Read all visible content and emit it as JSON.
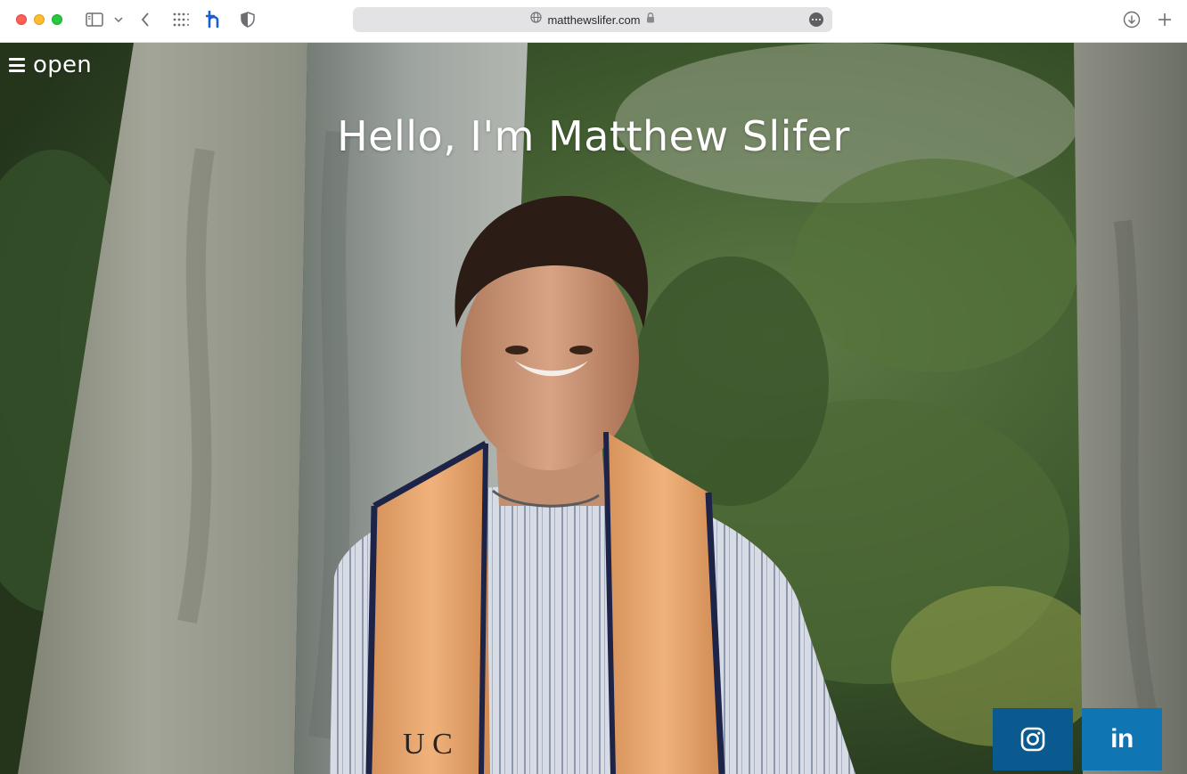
{
  "browser": {
    "url": "matthewslifer.com",
    "icons": [
      "sidebar-icon",
      "chevron-down-icon",
      "back-icon",
      "grid-icon",
      "honey-extension-icon",
      "shield-icon",
      "globe-icon",
      "lock-icon",
      "more-icon",
      "download-icon",
      "new-tab-icon"
    ]
  },
  "nav": {
    "menu_label": "open",
    "menu_icon": "hamburger-icon"
  },
  "hero": {
    "title": "Hello, I'm Matthew Slifer",
    "stole_letters": "U C"
  },
  "social": {
    "instagram_icon": "instagram-icon",
    "linkedin_label": "in",
    "instagram_color": "#0b5a8f",
    "linkedin_color": "#0f76b3"
  }
}
